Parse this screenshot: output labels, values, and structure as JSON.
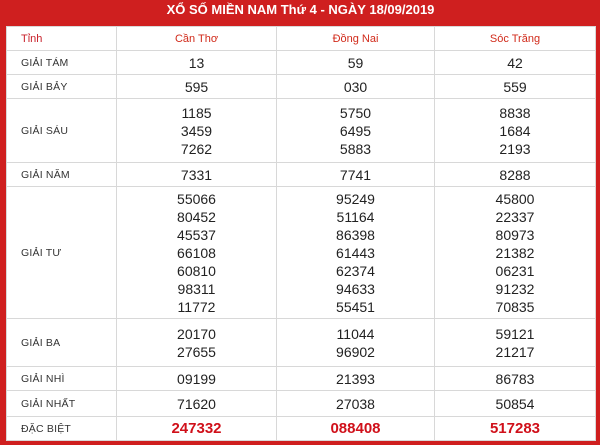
{
  "title": "XỔ SỐ MIỀN NAM Thứ 4 - NGÀY 18/09/2019",
  "header": {
    "label": "Tỉnh",
    "provinces": [
      "Cần Thơ",
      "Đồng Nai",
      "Sóc Trăng"
    ]
  },
  "prizes": [
    {
      "name": "GIẢI TÁM",
      "results": [
        [
          "13"
        ],
        [
          "59"
        ],
        [
          "42"
        ]
      ]
    },
    {
      "name": "GIẢI BẢY",
      "results": [
        [
          "595"
        ],
        [
          "030"
        ],
        [
          "559"
        ]
      ]
    },
    {
      "name": "GIẢI SÁU",
      "results": [
        [
          "1185",
          "3459",
          "7262"
        ],
        [
          "5750",
          "6495",
          "5883"
        ],
        [
          "8838",
          "1684",
          "2193"
        ]
      ]
    },
    {
      "name": "GIẢI NĂM",
      "results": [
        [
          "7331"
        ],
        [
          "7741"
        ],
        [
          "8288"
        ]
      ]
    },
    {
      "name": "GIẢI TƯ",
      "results": [
        [
          "55066",
          "80452",
          "45537",
          "66108",
          "60810",
          "98311",
          "11772"
        ],
        [
          "95249",
          "51164",
          "86398",
          "61443",
          "62374",
          "94633",
          "55451"
        ],
        [
          "45800",
          "22337",
          "80973",
          "21382",
          "06231",
          "91232",
          "70835"
        ]
      ]
    },
    {
      "name": "GIẢI BA",
      "results": [
        [
          "20170",
          "27655"
        ],
        [
          "11044",
          "96902"
        ],
        [
          "59121",
          "21217"
        ]
      ]
    },
    {
      "name": "GIẢI NHÌ",
      "results": [
        [
          "09199"
        ],
        [
          "21393"
        ],
        [
          "86783"
        ]
      ]
    },
    {
      "name": "GIẢI NHẤT",
      "results": [
        [
          "71620"
        ],
        [
          "27038"
        ],
        [
          "50854"
        ]
      ]
    },
    {
      "name": "ĐẶC BIỆT",
      "results": [
        [
          "247332"
        ],
        [
          "088408"
        ],
        [
          "517283"
        ]
      ]
    }
  ],
  "colors": {
    "frame": "#cf1f1f",
    "header_text": "#d12a1a",
    "special_text": "#d0101a"
  }
}
